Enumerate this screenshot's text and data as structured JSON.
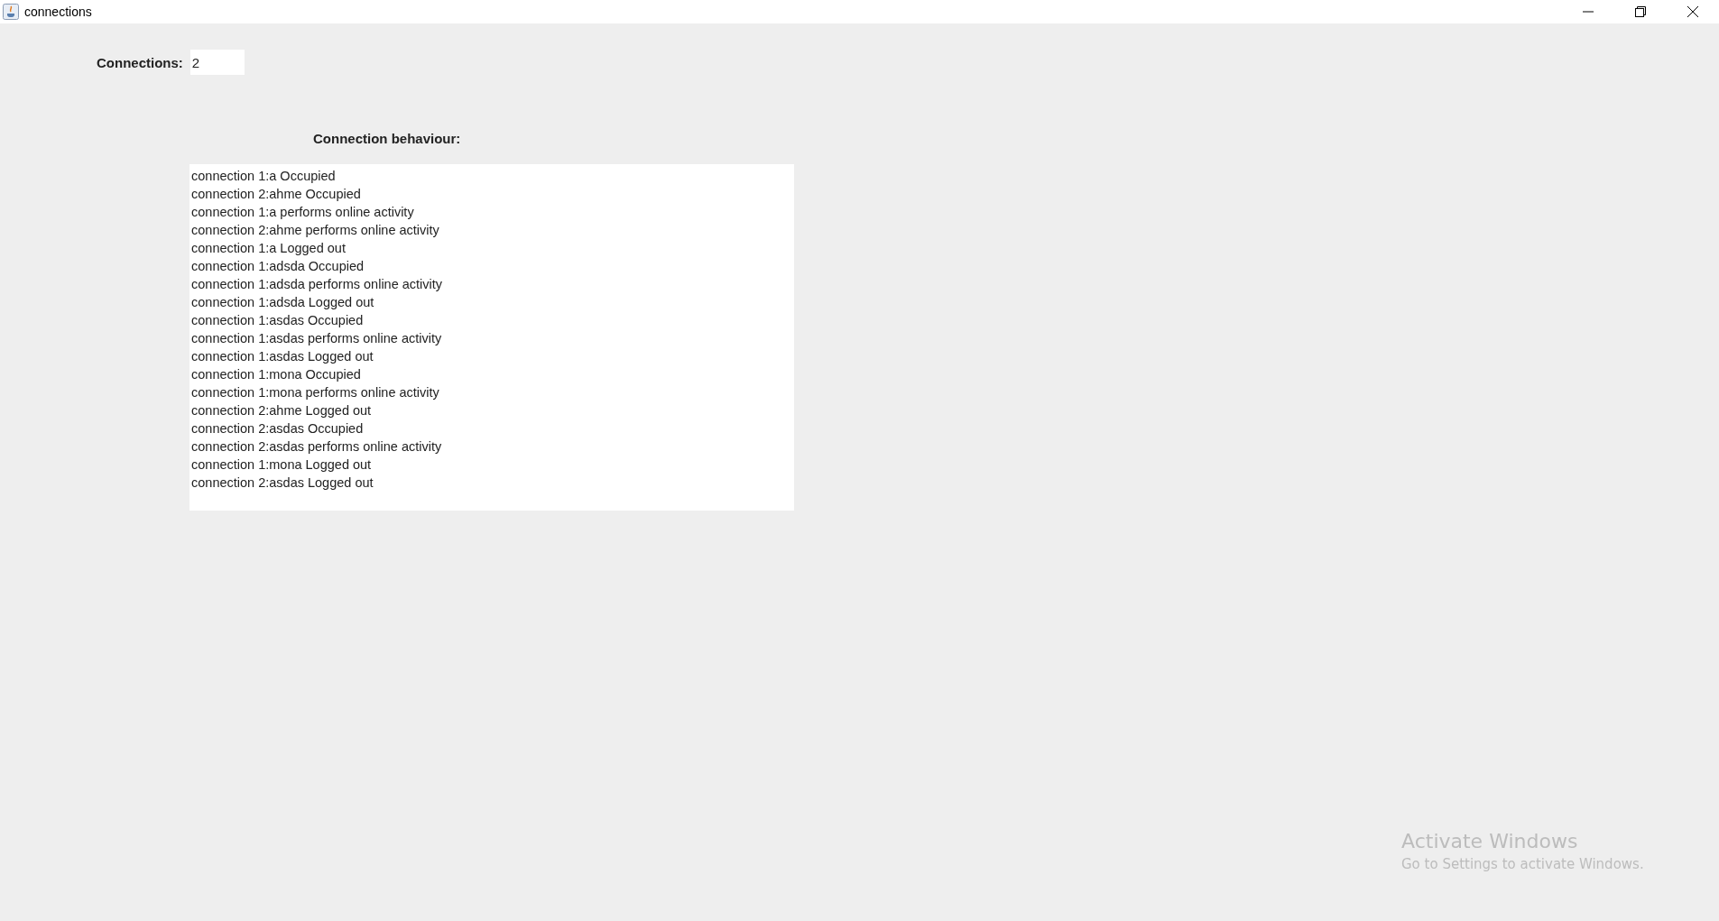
{
  "window": {
    "title": "connections"
  },
  "connections": {
    "label": "Connections:",
    "value": "2"
  },
  "behaviour": {
    "label": "Connection behaviour:",
    "lines": [
      "connection 1:a Occupied",
      "connection 2:ahme Occupied",
      "connection 1:a performs online activity",
      "connection 2:ahme performs online activity",
      "connection 1:a Logged out",
      "connection 1:adsda Occupied",
      "connection 1:adsda performs online activity",
      "connection 1:adsda Logged out",
      "connection 1:asdas Occupied",
      "connection 1:asdas performs online activity",
      "connection 1:asdas Logged out",
      "connection 1:mona Occupied",
      "connection 1:mona performs online activity",
      "connection 2:ahme Logged out",
      "connection 2:asdas Occupied",
      "connection 2:asdas performs online activity",
      "connection 1:mona Logged out",
      "connection 2:asdas Logged out"
    ]
  },
  "activation": {
    "title": "Activate Windows",
    "message": "Go to Settings to activate Windows."
  }
}
